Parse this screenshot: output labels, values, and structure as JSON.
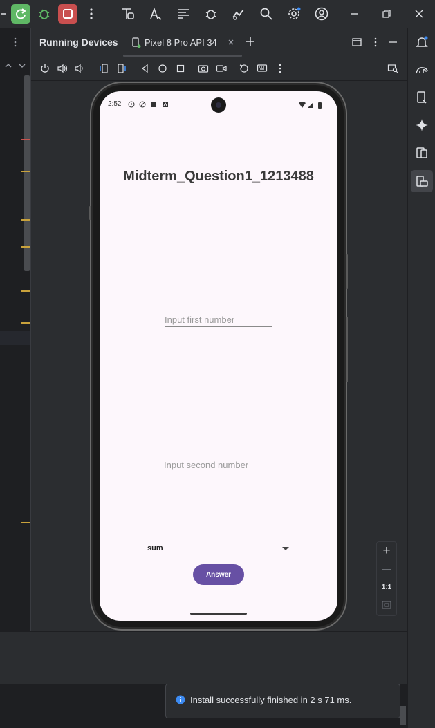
{
  "toolbar": {
    "icons": [
      "sync-icon",
      "debug-icon",
      "stop-icon",
      "more-vertical-icon",
      "layout-inspector-icon",
      "translate-icon",
      "logcat-icon",
      "bug-icon",
      "profiler-icon",
      "search-icon",
      "settings-icon",
      "account-icon"
    ],
    "window_controls": [
      "minimize-icon",
      "restore-icon",
      "close-icon"
    ]
  },
  "panel": {
    "title": "Running Devices",
    "tab_label": "Pixel 8 Pro API 34"
  },
  "phone": {
    "status_time": "2:52",
    "app_title": "Midterm_Question1_1213488",
    "first_placeholder": "Input first number",
    "second_placeholder": "Input second number",
    "spinner_value": "sum",
    "answer_button": "Answer"
  },
  "zoom": {
    "plus": "+",
    "minus": "—",
    "ratio": "1:1"
  },
  "notification": {
    "message": "Install successfully finished in 2 s 71 ms."
  },
  "colors": {
    "accent_purple": "#6750a4",
    "screen_bg": "#fdf7fc",
    "ide_bg": "#2b2d30",
    "green_button": "#5fb865",
    "red_button": "#c94f4f"
  }
}
